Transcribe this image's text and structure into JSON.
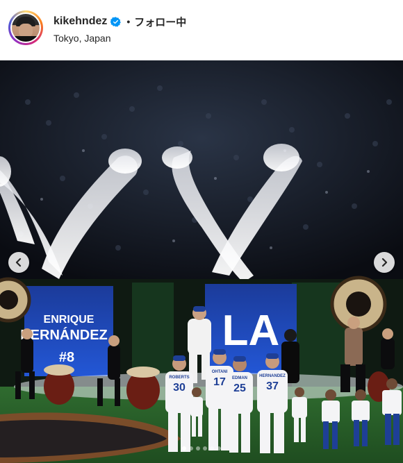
{
  "header": {
    "username": "kikehndez",
    "dot": "•",
    "follow_label": "フォロー中",
    "location": "Tokyo, Japan"
  },
  "icons": {
    "verified": "verified-badge-icon",
    "prev": "chevron-left-icon",
    "next": "chevron-right-icon"
  },
  "photo": {
    "board_first_name": "ENRIQUE",
    "board_last_name": "HERNÁNDEZ",
    "board_number": "#8",
    "logo_text": "LA",
    "jersey_numbers": [
      "30",
      "17",
      "25",
      "37"
    ],
    "jersey_names": [
      "ROBERTS",
      "OHTANI",
      "EDMAN",
      "HERNANDEZ"
    ]
  },
  "carousel": {
    "slide_count": 6,
    "active_index": 0
  },
  "colors": {
    "accent_blue": "#0095f6",
    "dodgers_blue": "#1f4fb0"
  }
}
